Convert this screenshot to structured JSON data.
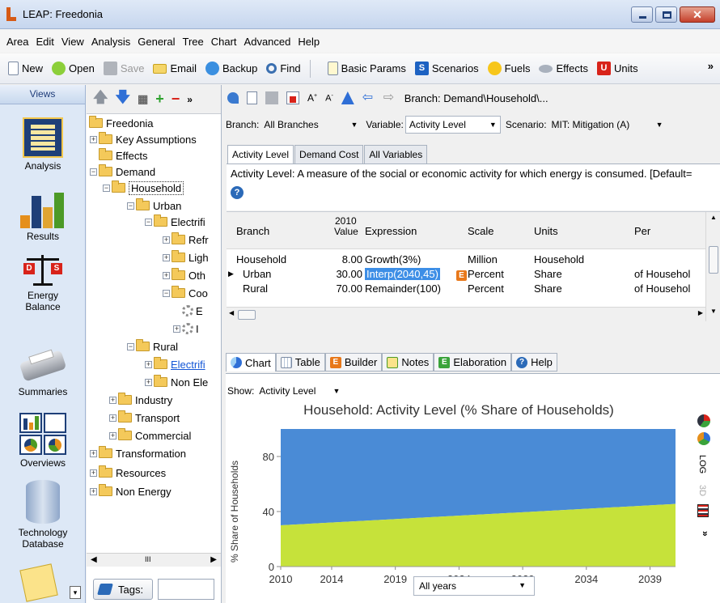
{
  "window": {
    "title": "LEAP: Freedonia"
  },
  "menu": [
    "Area",
    "Edit",
    "View",
    "Analysis",
    "General",
    "Tree",
    "Chart",
    "Advanced",
    "Help"
  ],
  "toolbar": {
    "new": "New",
    "open": "Open",
    "save": "Save",
    "email": "Email",
    "backup": "Backup",
    "find": "Find",
    "basic_params": "Basic Params",
    "scenarios": "Scenarios",
    "fuels": "Fuels",
    "effects": "Effects",
    "units": "Units",
    "more": "»"
  },
  "views": {
    "header": "Views",
    "items": [
      "Analysis",
      "Results",
      "Energy Balance",
      "Summaries",
      "Overviews",
      "Technology Database"
    ]
  },
  "tree": {
    "more": "»",
    "nodes": [
      "Freedonia",
      "Key Assumptions",
      "Effects",
      "Demand",
      "Household",
      "Urban",
      "Electrifi",
      "Refr",
      "Ligh",
      "Oth",
      "Coo",
      "E",
      "I",
      "Rural",
      "Electrifi",
      "Non Ele",
      "Industry",
      "Transport",
      "Commercial",
      "Transformation",
      "Resources",
      "Non Energy"
    ],
    "scroll_mid": "III",
    "tags_label": "Tags:"
  },
  "main": {
    "breadcrumb": "Branch: Demand\\Household\\...",
    "branch_label": "Branch:",
    "branch_value": "All Branches",
    "variable_label": "Variable:",
    "variable_value": "Activity Level",
    "scenario_label": "Scenario:",
    "scenario_value": "MIT: Mitigation (A)",
    "tabs": [
      "Activity Level",
      "Demand Cost",
      "All Variables"
    ],
    "description": "Activity Level: A measure of the social or economic activity for which energy is consumed. [Default=",
    "columns": {
      "branch": "Branch",
      "value_year": "2010",
      "value": "Value",
      "expression": "Expression",
      "scale": "Scale",
      "units": "Units",
      "per": "Per"
    },
    "rows": [
      {
        "branch": "Household",
        "value": "8.00",
        "expression": "Growth(3%)",
        "scale": "Million",
        "units": "Household",
        "per": ""
      },
      {
        "branch": "Urban",
        "value": "30.00",
        "expression": "Interp(2040,45)",
        "scale": "Percent",
        "units": "Share",
        "per": "of Househol"
      },
      {
        "branch": "Rural",
        "value": "70.00",
        "expression": "Remainder(100)",
        "scale": "Percent",
        "units": "Share",
        "per": "of Househol"
      }
    ],
    "bottom_tabs": [
      "Chart",
      "Table",
      "Builder",
      "Notes",
      "Elaboration",
      "Help"
    ],
    "show_label": "Show:",
    "show_value": "Activity Level",
    "all_years": "All years",
    "side_labels": {
      "log": "LOG",
      "three_d": "3D",
      "more": "»"
    }
  },
  "chart_data": {
    "type": "area",
    "title": "Household: Activity Level (% Share of Households)",
    "ylabel": "% Share of Households",
    "xlabel": "",
    "x": [
      2010,
      2040
    ],
    "xticks": [
      2010,
      2014,
      2019,
      2024,
      2029,
      2034,
      2039
    ],
    "yticks": [
      0,
      40,
      80
    ],
    "ylim": [
      0,
      100
    ],
    "series": [
      {
        "values": [
          30,
          45
        ],
        "color": "#c6e23a"
      },
      {
        "values": [
          70,
          55
        ],
        "color": "#4a8bd6"
      }
    ]
  }
}
